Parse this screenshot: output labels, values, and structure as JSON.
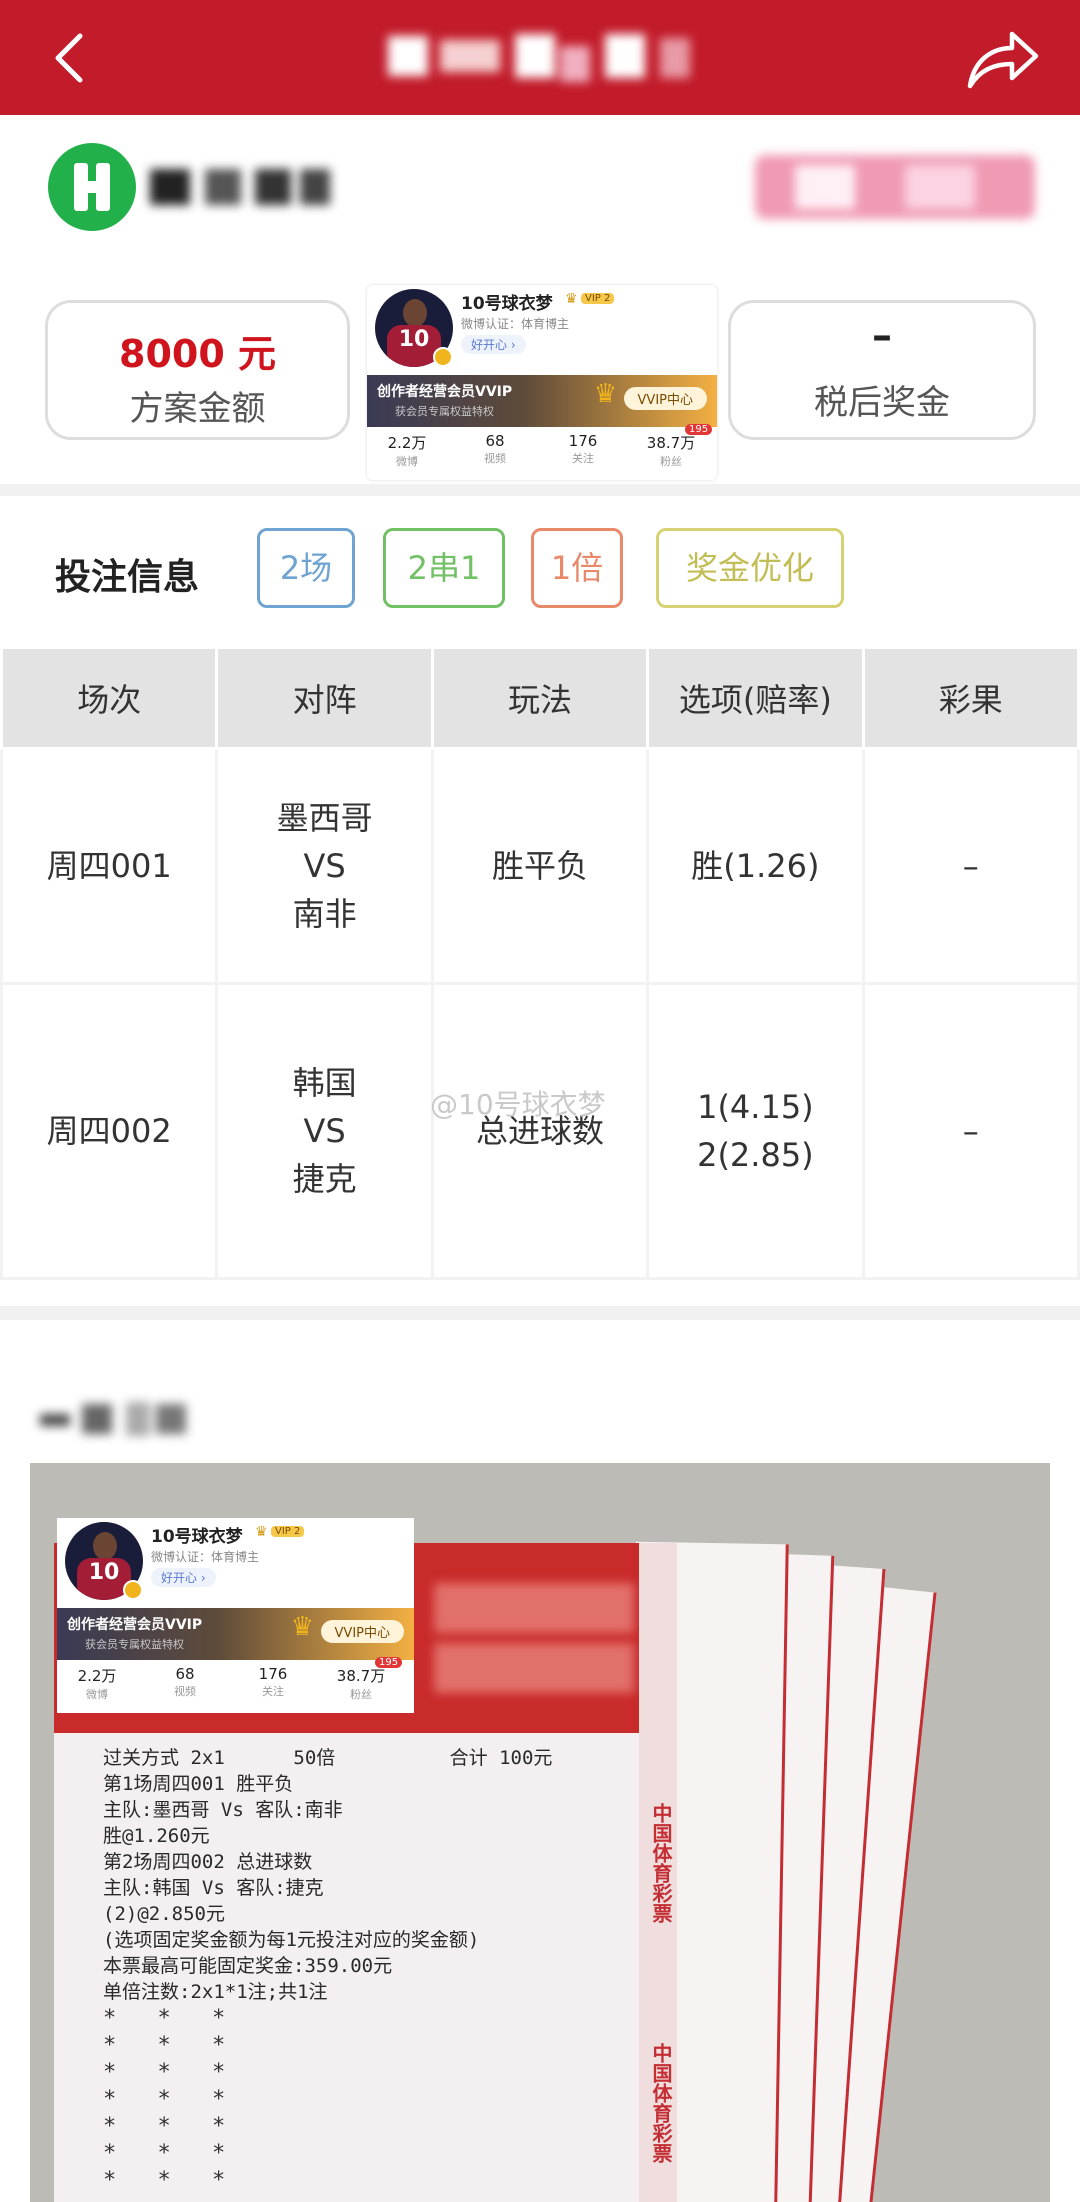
{
  "colors": {
    "header": "#c21b2a",
    "accent_red": "#d0141d",
    "tag_blue": "#6ea3d2",
    "tag_green": "#73c167",
    "tag_orange": "#e88a6a",
    "tag_yellow": "#d6d173"
  },
  "header": {
    "back_icon": "chevron-left-icon",
    "share_icon": "share-arrow-icon"
  },
  "summary": {
    "amount": "8000 元",
    "amount_label": "方案金额",
    "prize": "–",
    "prize_label": "税后奖金"
  },
  "profile": {
    "name": "10号球衣梦",
    "vip_badge": "VIP 2",
    "cert": "微博认证：体育博主",
    "button": "好开心 ›",
    "vip_bar_title": "创作者经营会员VVIP",
    "vip_bar_sub": "获会员专属权益特权",
    "vip_button": "VVIP中心",
    "jersey_number": "10",
    "stats": [
      {
        "num": "2.2万",
        "label": "微博"
      },
      {
        "num": "68",
        "label": "视频"
      },
      {
        "num": "176",
        "label": "关注"
      },
      {
        "num": "38.7万",
        "label": "粉丝"
      }
    ],
    "bubble": "195"
  },
  "bet_info": {
    "title": "投注信息",
    "tags": [
      "2场",
      "2串1",
      "1倍",
      "奖金优化"
    ],
    "columns": [
      "场次",
      "对阵",
      "玩法",
      "选项(赔率)",
      "彩果"
    ],
    "rows": [
      {
        "match_no": "周四001",
        "home": "墨西哥",
        "vs": "VS",
        "away": "南非",
        "play": "胜平负",
        "option1": "胜(1.26)",
        "option2": "",
        "result": "–"
      },
      {
        "match_no": "周四002",
        "home": "韩国",
        "vs": "VS",
        "away": "捷克",
        "play": "总进球数",
        "option1": "1(4.15)",
        "option2": "2(2.85)",
        "result": "–"
      }
    ]
  },
  "watermark": "@10号球衣梦",
  "ticket": {
    "lines": "过关方式 2x1      50倍          合计 100元\n第1场周四001 胜平负\n主队:墨西哥 Vs 客队:南非\n胜@1.260元\n第2场周四002 总进球数\n主队:韩国 Vs 客队:捷克\n(2)@2.850元\n(选项固定奖金额为每1元投注对应的奖金额)\n本票最高可能固定奖金:359.00元\n单倍注数:2x1*1注;共1注",
    "stripe_text": "中国体育彩票",
    "stripe_text2": "中国体育彩票",
    "stars": [
      "* * *",
      "* * *",
      "* * *",
      "* * *",
      "* * *",
      "* * *",
      "* * *",
      "* * *"
    ]
  }
}
